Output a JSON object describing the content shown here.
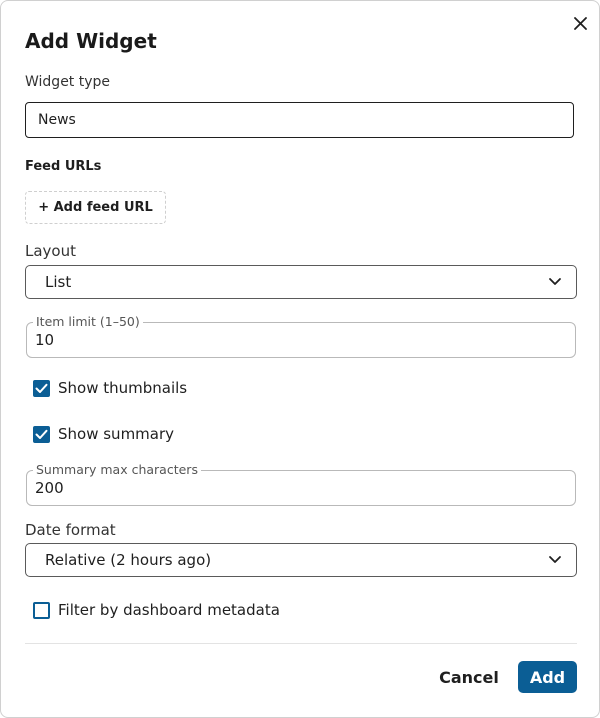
{
  "dialog": {
    "title": "Add Widget",
    "close_icon": "close-icon"
  },
  "widget_type": {
    "label": "Widget type",
    "value": "News"
  },
  "feed_urls": {
    "label": "Feed URLs",
    "add_button": "+ Add feed URL"
  },
  "layout": {
    "label": "Layout",
    "value": "List",
    "icon": "chevron-down-icon"
  },
  "item_limit": {
    "label": "Item limit (1–50)",
    "value": "10"
  },
  "show_thumbnails": {
    "label": "Show thumbnails",
    "checked": true
  },
  "show_summary": {
    "label": "Show summary",
    "checked": true
  },
  "summary_max": {
    "label": "Summary max characters",
    "value": "200"
  },
  "date_format": {
    "label": "Date format",
    "value": "Relative (2 hours ago)",
    "icon": "chevron-down-icon"
  },
  "filter_metadata": {
    "label": "Filter by dashboard metadata",
    "checked": false
  },
  "footer": {
    "cancel": "Cancel",
    "add": "Add"
  },
  "colors": {
    "primary": "#0b5e95",
    "text": "#1f1f1f",
    "border": "#b9b9b9"
  }
}
